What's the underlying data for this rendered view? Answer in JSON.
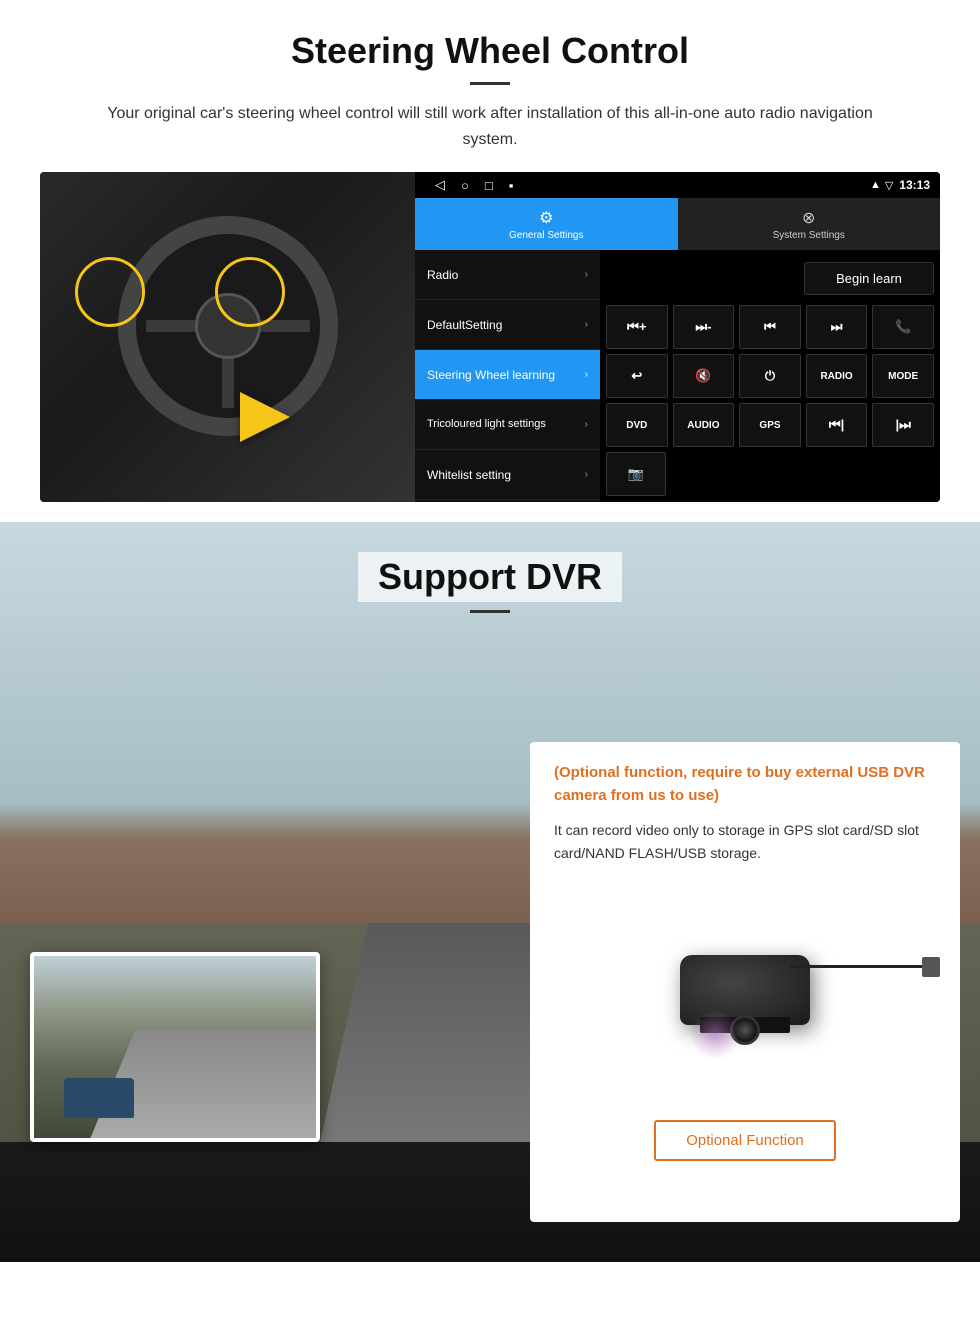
{
  "section1": {
    "title": "Steering Wheel Control",
    "description": "Your original car's steering wheel control will still work after installation of this all-in-one auto radio navigation system.",
    "status_bar": {
      "time": "13:13",
      "icons": [
        "signal",
        "wifi",
        "battery"
      ]
    },
    "tabs": {
      "general": {
        "icon": "⚙",
        "label": "General Settings"
      },
      "system": {
        "icon": "⊗",
        "label": "System Settings"
      }
    },
    "menu_items": [
      {
        "label": "Radio",
        "active": false
      },
      {
        "label": "DefaultSetting",
        "active": false
      },
      {
        "label": "Steering Wheel learning",
        "active": true
      },
      {
        "label": "Tricoloured light settings",
        "active": false
      },
      {
        "label": "Whitelist setting",
        "active": false
      }
    ],
    "begin_learn_label": "Begin learn",
    "control_buttons": {
      "row1": [
        "⏮+",
        "⏭-",
        "⏮|",
        "|⏭",
        "📞"
      ],
      "row2": [
        "↩",
        "🔇",
        "⏻",
        "RADIO",
        "MODE"
      ],
      "row3": [
        "DVD",
        "AUDIO",
        "GPS",
        "⏭|",
        "⏭|"
      ],
      "row4": [
        "📷"
      ]
    }
  },
  "section2": {
    "title": "Support DVR",
    "optional_text": "(Optional function, require to buy external USB DVR camera from us to use)",
    "description": "It can record video only to storage in GPS slot card/SD slot card/NAND FLASH/USB storage.",
    "optional_button_label": "Optional Function"
  }
}
